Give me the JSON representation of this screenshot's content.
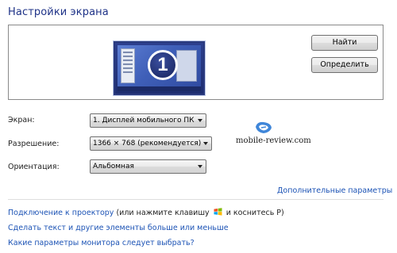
{
  "page": {
    "title": "Настройки экрана"
  },
  "preview": {
    "monitor_number": "1",
    "find_button": "Найти",
    "identify_button": "Определить"
  },
  "settings": {
    "display": {
      "label": "Экран:",
      "value": "1. Дисплей мобильного ПК"
    },
    "resolution": {
      "label": "Разрешение:",
      "value": "1366 × 768 (рекомендуется)"
    },
    "orientation": {
      "label": "Ориентация:",
      "value": "Альбомная"
    }
  },
  "watermark": {
    "text": "mobile-review.com"
  },
  "links": {
    "advanced": "Дополнительные параметры",
    "projector": "Подключение к проектору",
    "projector_hint_before": "(или нажмите клавишу",
    "projector_hint_after": "и коснитесь P)",
    "text_size": "Сделать текст и другие элементы больше или меньше",
    "which_settings": "Какие параметры монитора следует выбрать?"
  },
  "colors": {
    "link": "#1c53b5",
    "title": "#1e3287",
    "monitor": "#2c3f8e"
  },
  "icons": {
    "win_key": "windows-logo-icon",
    "watermark": "mobile-review-logo-icon",
    "dropdown": "chevron-down-icon"
  }
}
